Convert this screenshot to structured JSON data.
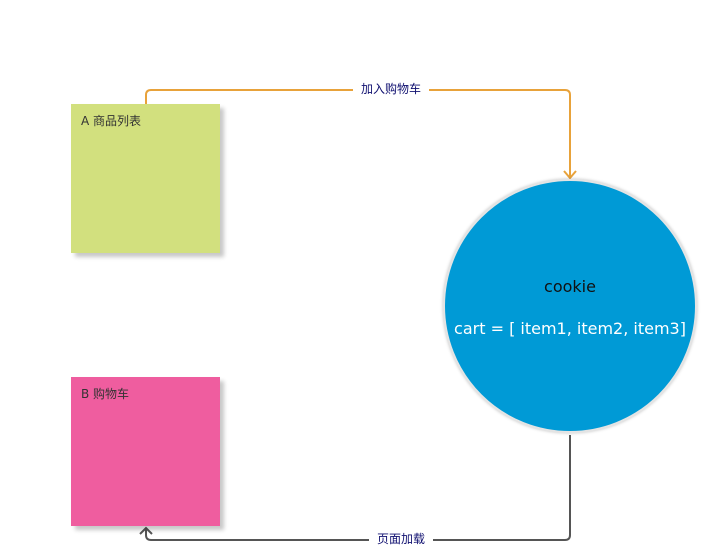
{
  "colors": {
    "note_a": "#d2e07e",
    "note_b": "#ef5d9f",
    "circle": "#009ad6",
    "arrow_add": "#e8a23a",
    "arrow_load": "#555555"
  },
  "nodes": {
    "note_a": {
      "label": "A 商品列表"
    },
    "note_b": {
      "label": "B 购物车"
    },
    "cookie": {
      "title": "cookie",
      "body": "cart = [ item1, item2, item3]"
    }
  },
  "edges": {
    "add_to_cart": {
      "label": "加入购物车"
    },
    "page_load": {
      "label": "页面加载"
    }
  }
}
